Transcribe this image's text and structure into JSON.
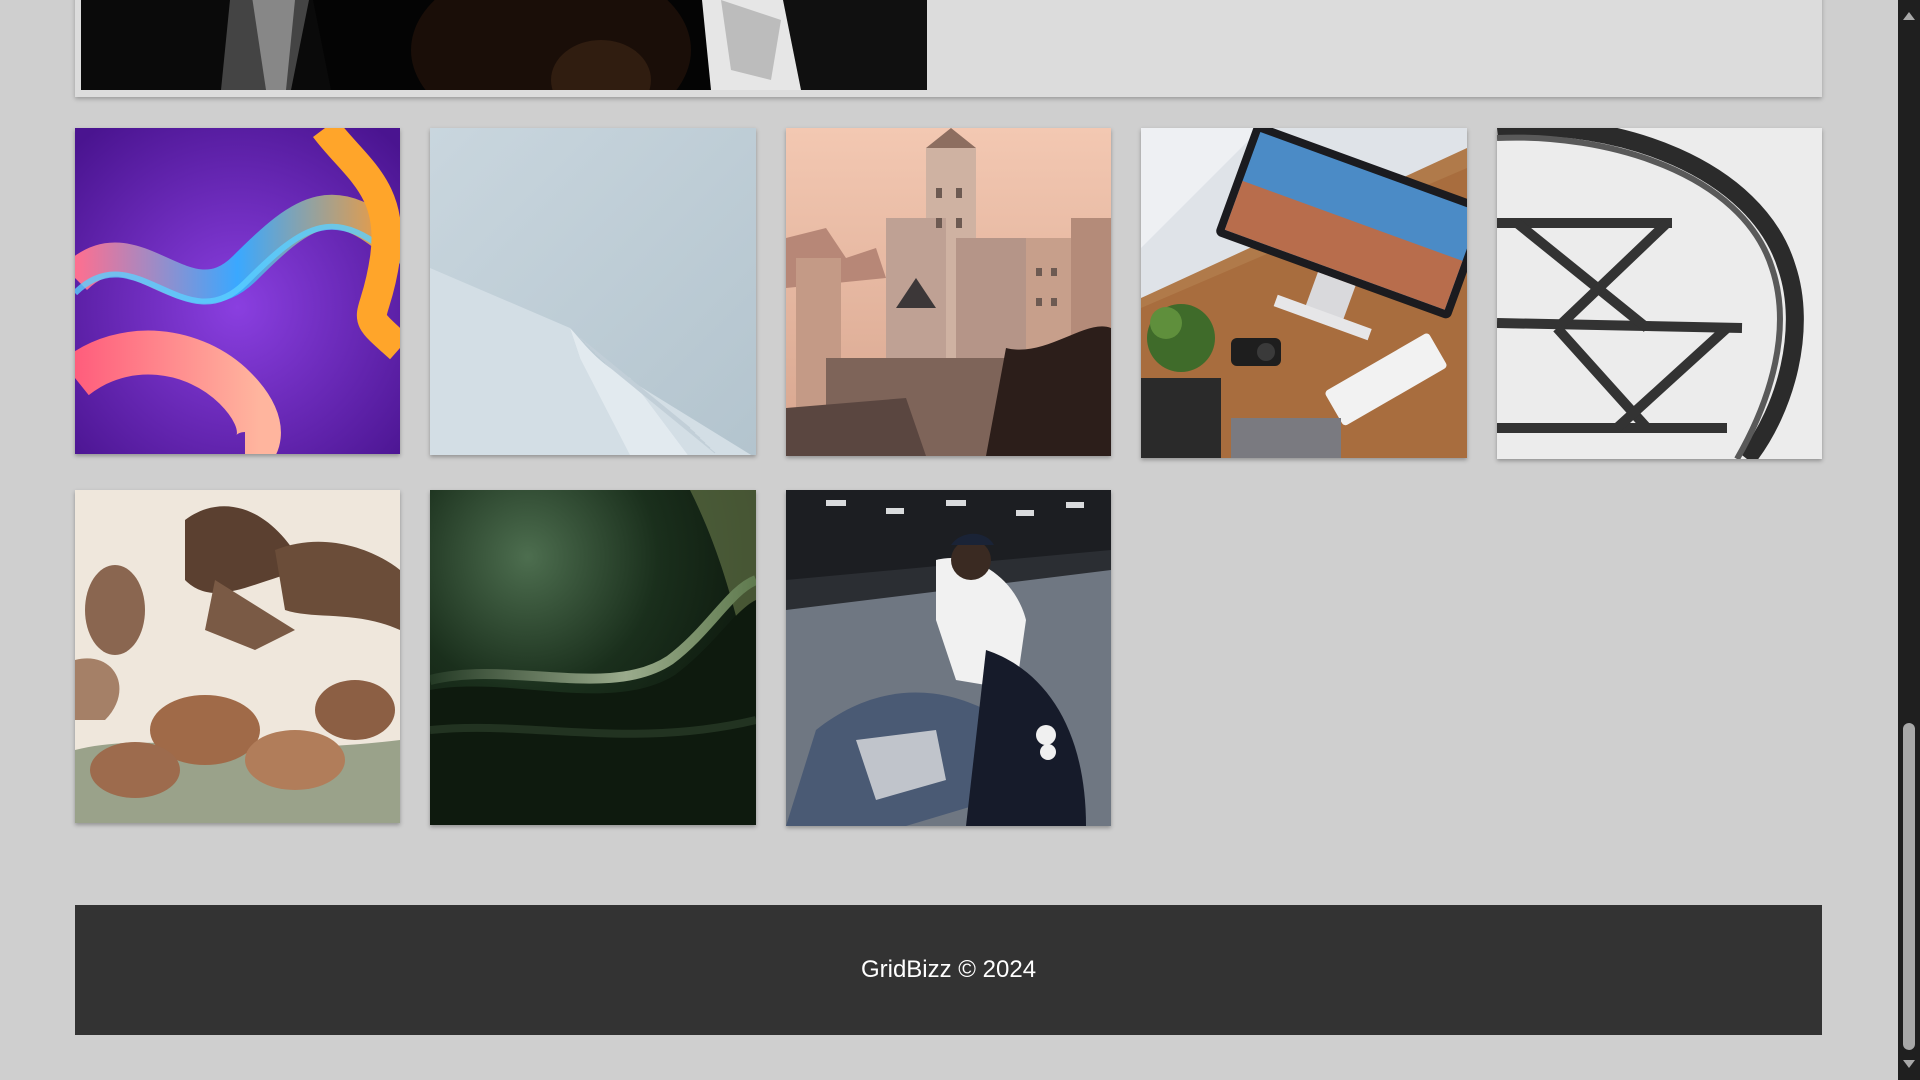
{
  "footer": {
    "text": "GridBizz © 2024"
  },
  "gallery": {
    "featured_image": "portrait-dark-photo",
    "images": [
      "colorful-abstract-waves",
      "white-minimal-architecture",
      "castle-city-skyline",
      "desk-monitor-workspace",
      "steel-structure-bw",
      "birds-illustration",
      "dark-green-abstract",
      "man-on-phone-sitting"
    ]
  },
  "colors": {
    "background": "#cfcfcf",
    "footer_bg": "#333333",
    "footer_text": "#ffffff"
  }
}
